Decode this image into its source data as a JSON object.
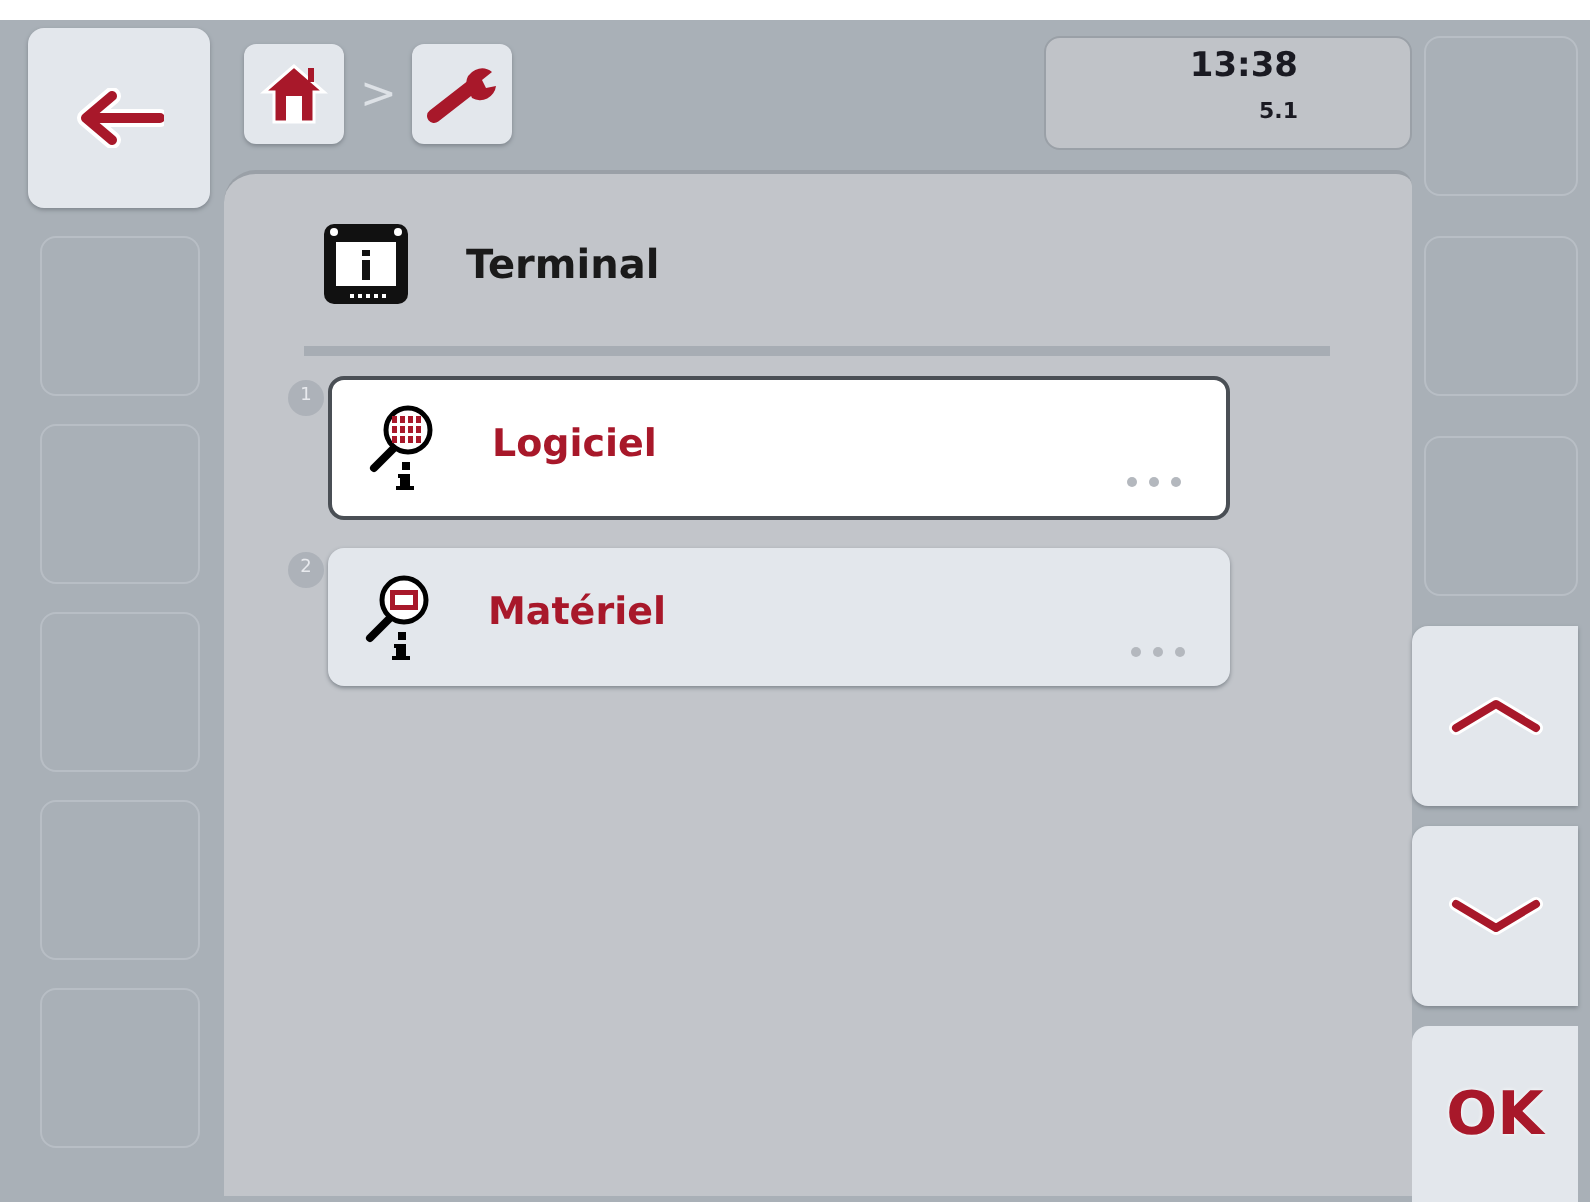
{
  "left_softkeys": [
    {
      "kind": "back"
    },
    {
      "kind": "empty"
    },
    {
      "kind": "empty"
    },
    {
      "kind": "empty"
    },
    {
      "kind": "empty"
    },
    {
      "kind": "empty"
    }
  ],
  "breadcrumb": {
    "items": [
      {
        "kind": "home"
      },
      {
        "kind": "settings"
      }
    ],
    "separator": ">"
  },
  "status": {
    "time": "13:38",
    "version": "5.1"
  },
  "heading": {
    "title": "Terminal"
  },
  "items": [
    {
      "number": "1",
      "label": "Logiciel",
      "kind": "software",
      "selected": true
    },
    {
      "number": "2",
      "label": "Matériel",
      "kind": "hardware",
      "selected": false
    }
  ],
  "right_softkeys": [
    {
      "kind": "empty"
    },
    {
      "kind": "empty"
    },
    {
      "kind": "empty"
    },
    {
      "kind": "up"
    },
    {
      "kind": "down"
    },
    {
      "kind": "ok",
      "label": "OK"
    }
  ]
}
